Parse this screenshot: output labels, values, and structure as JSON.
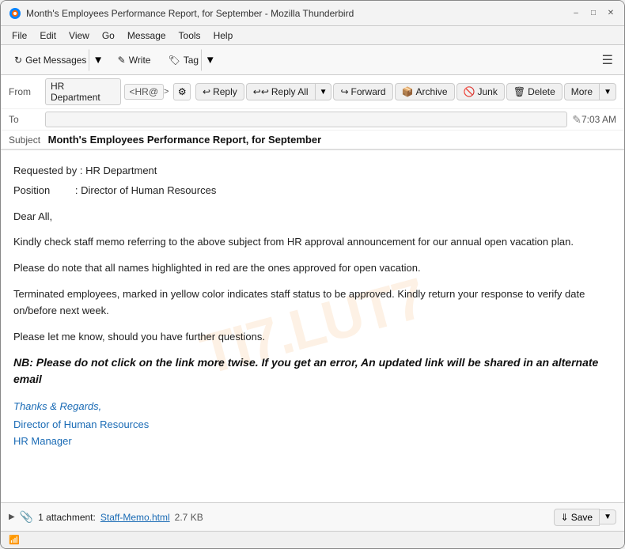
{
  "window": {
    "title": "Month's Employees Performance Report, for September - Mozilla Thunderbird",
    "icon": "thunderbird"
  },
  "menu": {
    "items": [
      "File",
      "Edit",
      "View",
      "Go",
      "Message",
      "Tools",
      "Help"
    ]
  },
  "toolbar": {
    "get_messages_label": "Get Messages",
    "write_label": "Write",
    "tag_label": "Tag"
  },
  "email_actions": {
    "from_label": "From",
    "from_name": "HR Department",
    "from_email": "<HR@",
    "reply_label": "Reply",
    "reply_all_label": "Reply All",
    "forward_label": "Forward",
    "archive_label": "Archive",
    "junk_label": "Junk",
    "delete_label": "Delete",
    "more_label": "More",
    "to_label": "To",
    "time": "7:03 AM",
    "subject_label": "Subject",
    "subject_value": "Month's Employees Performance Report, for September"
  },
  "body": {
    "requested_by_label": "Requested by",
    "requested_by_value": ": HR Department",
    "position_label": "Position",
    "position_value": ": Director of Human Resources",
    "greeting": "Dear All,",
    "para1": "Kindly check staff memo referring to the above subject from HR approval announcement for our annual open vacation plan.",
    "para2": "Please do note that all names highlighted in red are the ones approved for open vacation.",
    "para3": "Terminated employees, marked in yellow color indicates staff status to be approved. Kindly return your response to verify date on/before next week.",
    "para4": "Please let me know, should you have further questions.",
    "nb": "NB: Please do not click on the link more twise. If you get an error, An updated link will be shared in an alternate email",
    "regards": "Thanks & Regards,",
    "director": "Director of Human Resources",
    "manager": "HR Manager",
    "watermark": "TI7.LUT7"
  },
  "attachment": {
    "label": "1 attachment:",
    "name": "Staff-Memo.html",
    "size": "2.7 KB",
    "save_label": "Save"
  },
  "status_bar": {
    "icon": "wifi"
  }
}
